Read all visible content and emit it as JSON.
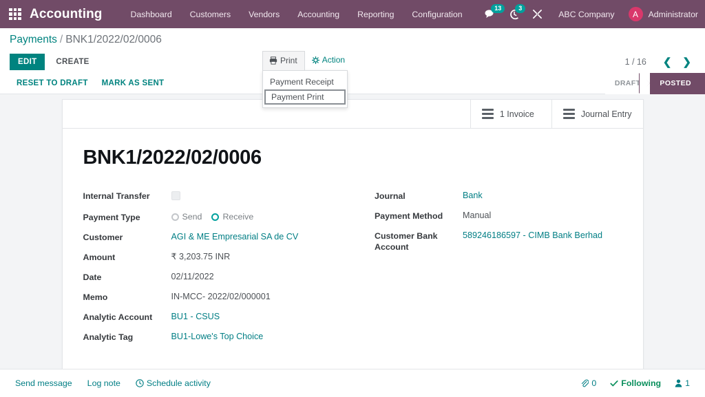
{
  "navbar": {
    "apps_icon": "apps-grid-icon",
    "brand": "Accounting",
    "menu": [
      {
        "label": "Dashboard"
      },
      {
        "label": "Customers"
      },
      {
        "label": "Vendors"
      },
      {
        "label": "Accounting"
      },
      {
        "label": "Reporting"
      },
      {
        "label": "Configuration"
      }
    ],
    "messages_icon": "chat-bubble-icon",
    "messages_count": "13",
    "activities_icon": "clock-icon",
    "activities_count": "3",
    "tools_icon": "wrench-icon",
    "company": "ABC Company",
    "avatar_initial": "A",
    "user": "Administrator",
    "bg_color": "#714B67",
    "badge_color": "#00A09D",
    "avatar_color": "#D9386B"
  },
  "breadcrumb": {
    "root": "Payments",
    "separator": "/",
    "current": "BNK1/2022/02/0006"
  },
  "controls": {
    "edit_label": "EDIT",
    "create_label": "CREATE",
    "print_label": "Print",
    "print_icon": "printer-icon",
    "action_label": "Action",
    "action_icon": "gear-icon",
    "print_menu": [
      {
        "label": "Payment Receipt",
        "focused": false
      },
      {
        "label": "Payment Print",
        "focused": true
      }
    ],
    "pager": "1 / 16",
    "prev_icon": "chevron-left-icon",
    "next_icon": "chevron-right-icon",
    "reset_label": "RESET TO DRAFT",
    "mark_sent_label": "MARK AS SENT",
    "statuses": [
      {
        "label": "DRAFT",
        "active": false
      },
      {
        "label": "POSTED",
        "active": true
      }
    ],
    "accent_teal": "#00837F",
    "status_active_color": "#714B67"
  },
  "smart_buttons": [
    {
      "icon": "bars-icon",
      "label": "1 Invoice"
    },
    {
      "icon": "bars-icon",
      "label": "Journal Entry"
    }
  ],
  "form": {
    "title": "BNK1/2022/02/0006",
    "left": [
      {
        "label": "Internal Transfer",
        "type": "checkbox",
        "checked": false
      },
      {
        "label": "Payment Type",
        "type": "radio",
        "options": [
          {
            "label": "Send",
            "selected": false
          },
          {
            "label": "Receive",
            "selected": true
          }
        ]
      },
      {
        "label": "Customer",
        "type": "link",
        "value": "AGI & ME Empresarial SA de CV"
      },
      {
        "label": "Amount",
        "type": "text",
        "value": "₹ 3,203.75 INR"
      },
      {
        "label": "Date",
        "type": "text",
        "value": "02/11/2022"
      },
      {
        "label": "Memo",
        "type": "text",
        "value": "IN-MCC- 2022/02/000001"
      },
      {
        "label": "Analytic Account",
        "type": "link",
        "value": "BU1 - CSUS"
      },
      {
        "label": "Analytic Tag",
        "type": "link",
        "value": "BU1-Lowe's Top Choice"
      }
    ],
    "right": [
      {
        "label": "Journal",
        "type": "link",
        "value": "Bank"
      },
      {
        "label": "Payment Method",
        "type": "text",
        "value": "Manual"
      },
      {
        "label": "Customer Bank Account",
        "type": "link",
        "value": "589246186597 - CIMB Bank Berhad"
      }
    ]
  },
  "chatter": {
    "send_message": "Send message",
    "log_note": "Log note",
    "schedule_activity": "Schedule activity",
    "schedule_icon": "clock-icon",
    "attachment_icon": "paperclip-icon",
    "attachment_count": "0",
    "following_icon": "check-icon",
    "following_label": "Following",
    "followers_icon": "user-icon",
    "followers_count": "1"
  }
}
